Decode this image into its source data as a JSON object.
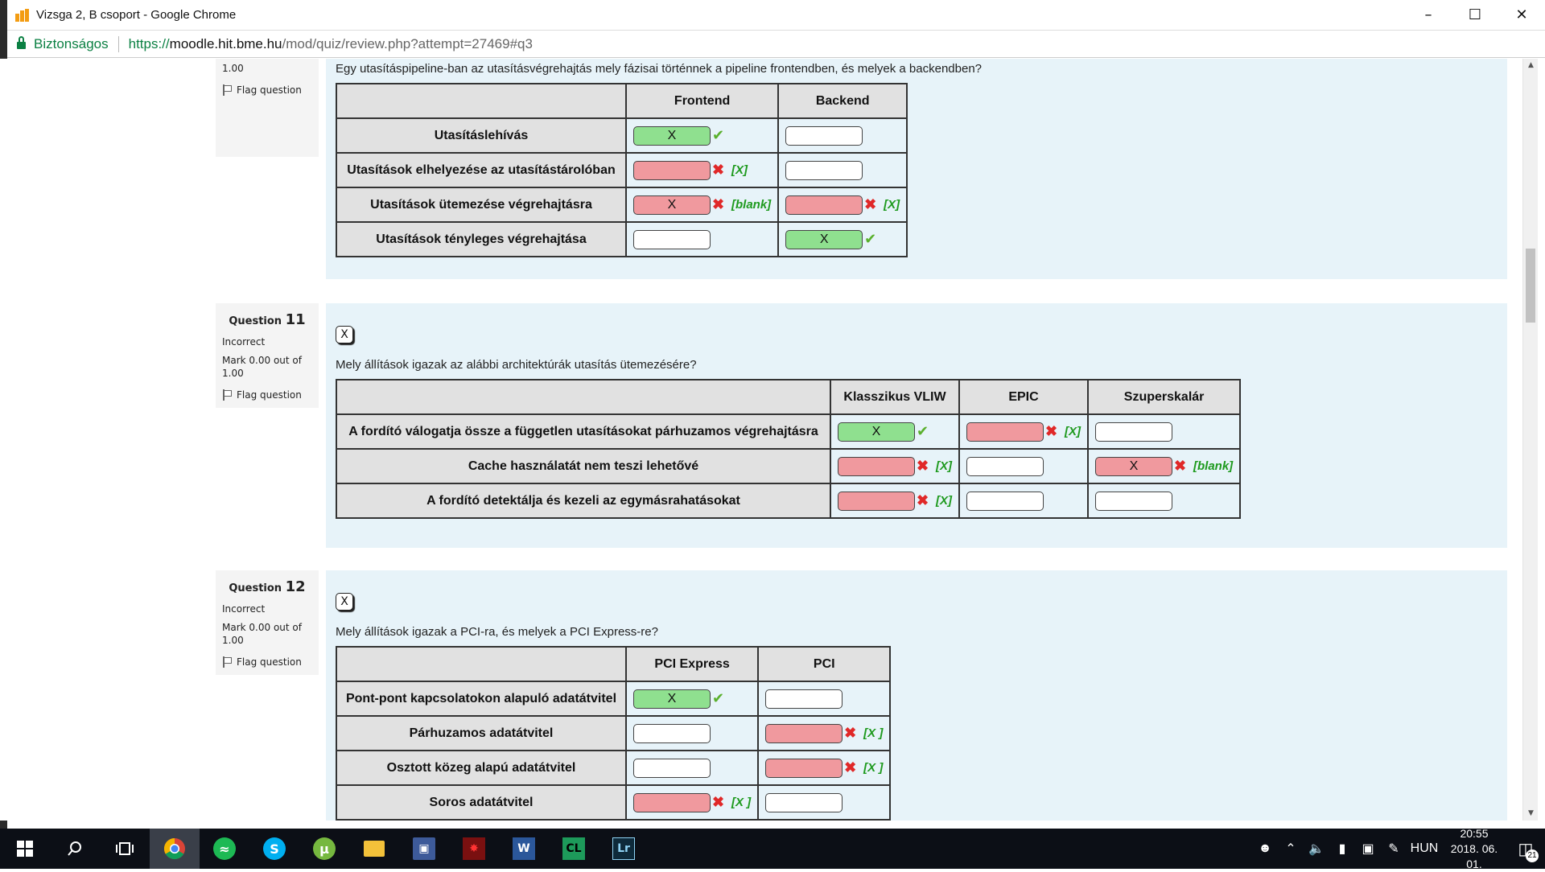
{
  "window": {
    "title": "Vizsga 2, B csoport - Google Chrome"
  },
  "address": {
    "secure_label": "Biztonságos",
    "scheme": "https://",
    "host": "moodle.hit.bme.hu",
    "path": "/mod/quiz/review.php?attempt=27469#q3"
  },
  "q10": {
    "mark_tail": "1.00",
    "flag_label": "Flag question",
    "text": "Egy utasításpipeline-ban az utasításvégrehajtás mely fázisai történnek a pipeline frontendben, és melyek a backendben?",
    "columns": [
      "Frontend",
      "Backend"
    ],
    "rows": [
      {
        "label": "Utasításlehívás",
        "cells": [
          {
            "value": "X",
            "state": "correct",
            "mark": "✔",
            "correction": ""
          },
          {
            "value": "",
            "state": "empty",
            "mark": "",
            "correction": ""
          }
        ]
      },
      {
        "label": "Utasítások elhelyezése az utasítástárolóban",
        "cells": [
          {
            "value": "",
            "state": "incorrect",
            "mark": "✖",
            "correction": "[X]"
          },
          {
            "value": "",
            "state": "empty",
            "mark": "",
            "correction": ""
          }
        ]
      },
      {
        "label": "Utasítások ütemezése végrehajtásra",
        "cells": [
          {
            "value": "X",
            "state": "incorrect",
            "mark": "✖",
            "correction": "[blank]"
          },
          {
            "value": "",
            "state": "incorrect",
            "mark": "✖",
            "correction": "[X]"
          }
        ]
      },
      {
        "label": "Utasítások tényleges végrehajtása",
        "cells": [
          {
            "value": "",
            "state": "empty",
            "mark": "",
            "correction": ""
          },
          {
            "value": "X",
            "state": "correct",
            "mark": "✔",
            "correction": ""
          }
        ]
      }
    ]
  },
  "q11": {
    "question_label": "Question",
    "number": "11",
    "status": "Incorrect",
    "mark": "Mark 0.00 out of 1.00",
    "flag_label": "Flag question",
    "x_button": "X",
    "text": "Mely állítások igazak az alábbi architektúrák utasítás ütemezésére?",
    "columns": [
      "Klasszikus VLIW",
      "EPIC",
      "Szuperskalár"
    ],
    "rows": [
      {
        "label": "A fordító válogatja össze a független utasításokat párhuzamos végrehajtásra",
        "cells": [
          {
            "value": "X",
            "state": "correct",
            "mark": "✔",
            "correction": ""
          },
          {
            "value": "",
            "state": "incorrect",
            "mark": "✖",
            "correction": "[X]"
          },
          {
            "value": "",
            "state": "empty",
            "mark": "",
            "correction": ""
          }
        ]
      },
      {
        "label": "Cache használatát nem teszi lehetővé",
        "cells": [
          {
            "value": "",
            "state": "incorrect",
            "mark": "✖",
            "correction": "[X]"
          },
          {
            "value": "",
            "state": "empty",
            "mark": "",
            "correction": ""
          },
          {
            "value": "X",
            "state": "incorrect",
            "mark": "✖",
            "correction": "[blank]"
          }
        ]
      },
      {
        "label": "A fordító detektálja és kezeli az egymásrahatásokat",
        "cells": [
          {
            "value": "",
            "state": "incorrect",
            "mark": "✖",
            "correction": "[X]"
          },
          {
            "value": "",
            "state": "empty",
            "mark": "",
            "correction": ""
          },
          {
            "value": "",
            "state": "empty",
            "mark": "",
            "correction": ""
          }
        ]
      }
    ]
  },
  "q12": {
    "question_label": "Question",
    "number": "12",
    "status": "Incorrect",
    "mark": "Mark 0.00 out of 1.00",
    "flag_label": "Flag question",
    "x_button": "X",
    "text": "Mely állítások igazak a PCI-ra, és melyek a PCI Express-re?",
    "columns": [
      "PCI Express",
      "PCI"
    ],
    "rows": [
      {
        "label": "Pont-pont kapcsolatokon alapuló adatátvitel",
        "cells": [
          {
            "value": "X",
            "state": "correct",
            "mark": "✔",
            "correction": ""
          },
          {
            "value": "",
            "state": "empty",
            "mark": "",
            "correction": ""
          }
        ]
      },
      {
        "label": "Párhuzamos adatátvitel",
        "cells": [
          {
            "value": "",
            "state": "empty",
            "mark": "",
            "correction": ""
          },
          {
            "value": "",
            "state": "incorrect",
            "mark": "✖",
            "correction": "[X ]"
          }
        ]
      },
      {
        "label": "Osztott közeg alapú adatátvitel",
        "cells": [
          {
            "value": "",
            "state": "empty",
            "mark": "",
            "correction": ""
          },
          {
            "value": "",
            "state": "incorrect",
            "mark": "✖",
            "correction": "[X ]"
          }
        ]
      },
      {
        "label": "Soros adatátvitel",
        "cells": [
          {
            "value": "",
            "state": "incorrect",
            "mark": "✖",
            "correction": "[X ]"
          },
          {
            "value": "",
            "state": "empty",
            "mark": "",
            "correction": ""
          }
        ]
      }
    ]
  },
  "taskbar": {
    "language": "HUN",
    "time": "20:55",
    "date": "2018. 06. 01.",
    "notification_count": "21",
    "icons": [
      "windows-start-icon",
      "search-icon",
      "task-view-icon",
      "chrome-icon",
      "spotify-icon",
      "skype-icon",
      "utorrent-icon",
      "file-explorer-icon",
      "save-disk-icon",
      "game-icon",
      "word-icon",
      "clion-icon",
      "lightroom-icon"
    ]
  },
  "colors": {
    "panel_bg": "#e7f3f9",
    "correct_bg": "#8fe08f",
    "incorrect_bg": "#f0999e",
    "correction_text": "#1e9a1e",
    "secure_green": "#0b8043"
  }
}
